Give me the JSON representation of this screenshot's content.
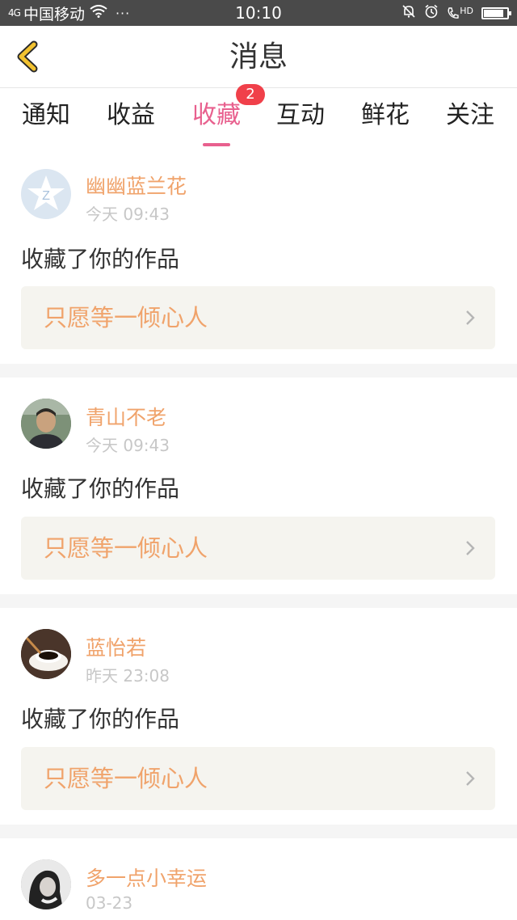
{
  "status_bar": {
    "signal": "4G",
    "carrier": "中国移动",
    "time": "10:10",
    "hd": "HD",
    "dots": "···",
    "battery_level": 0.85,
    "icons": [
      "signal-icon",
      "wifi-icon",
      "silent-bell-icon",
      "alarm-icon",
      "hd-call-icon",
      "battery-icon"
    ]
  },
  "nav": {
    "title": "消息",
    "back_icon": "chevron-left-icon",
    "accent": "#f2c230"
  },
  "tabs": [
    {
      "label": "通知"
    },
    {
      "label": "收益"
    },
    {
      "label": "收藏"
    },
    {
      "label": "互动"
    },
    {
      "label": "鲜花"
    },
    {
      "label": "关注"
    }
  ],
  "active_tab": "收藏",
  "active_badge": "2",
  "colors": {
    "active_tab": "#e8608e",
    "username": "#f0a36b",
    "badge": "#f0404a"
  },
  "items": [
    {
      "user": "幽幽蓝兰花",
      "time": "今天 09:43",
      "action": "收藏了你的作品",
      "work": "只愿等一倾心人"
    },
    {
      "user": "青山不老",
      "time": "今天 09:43",
      "action": "收藏了你的作品",
      "work": "只愿等一倾心人"
    },
    {
      "user": "蓝怡若",
      "time": "昨天 23:08",
      "action": "收藏了你的作品",
      "work": "只愿等一倾心人"
    },
    {
      "user": "多一点小幸运",
      "time": "03-23"
    }
  ]
}
